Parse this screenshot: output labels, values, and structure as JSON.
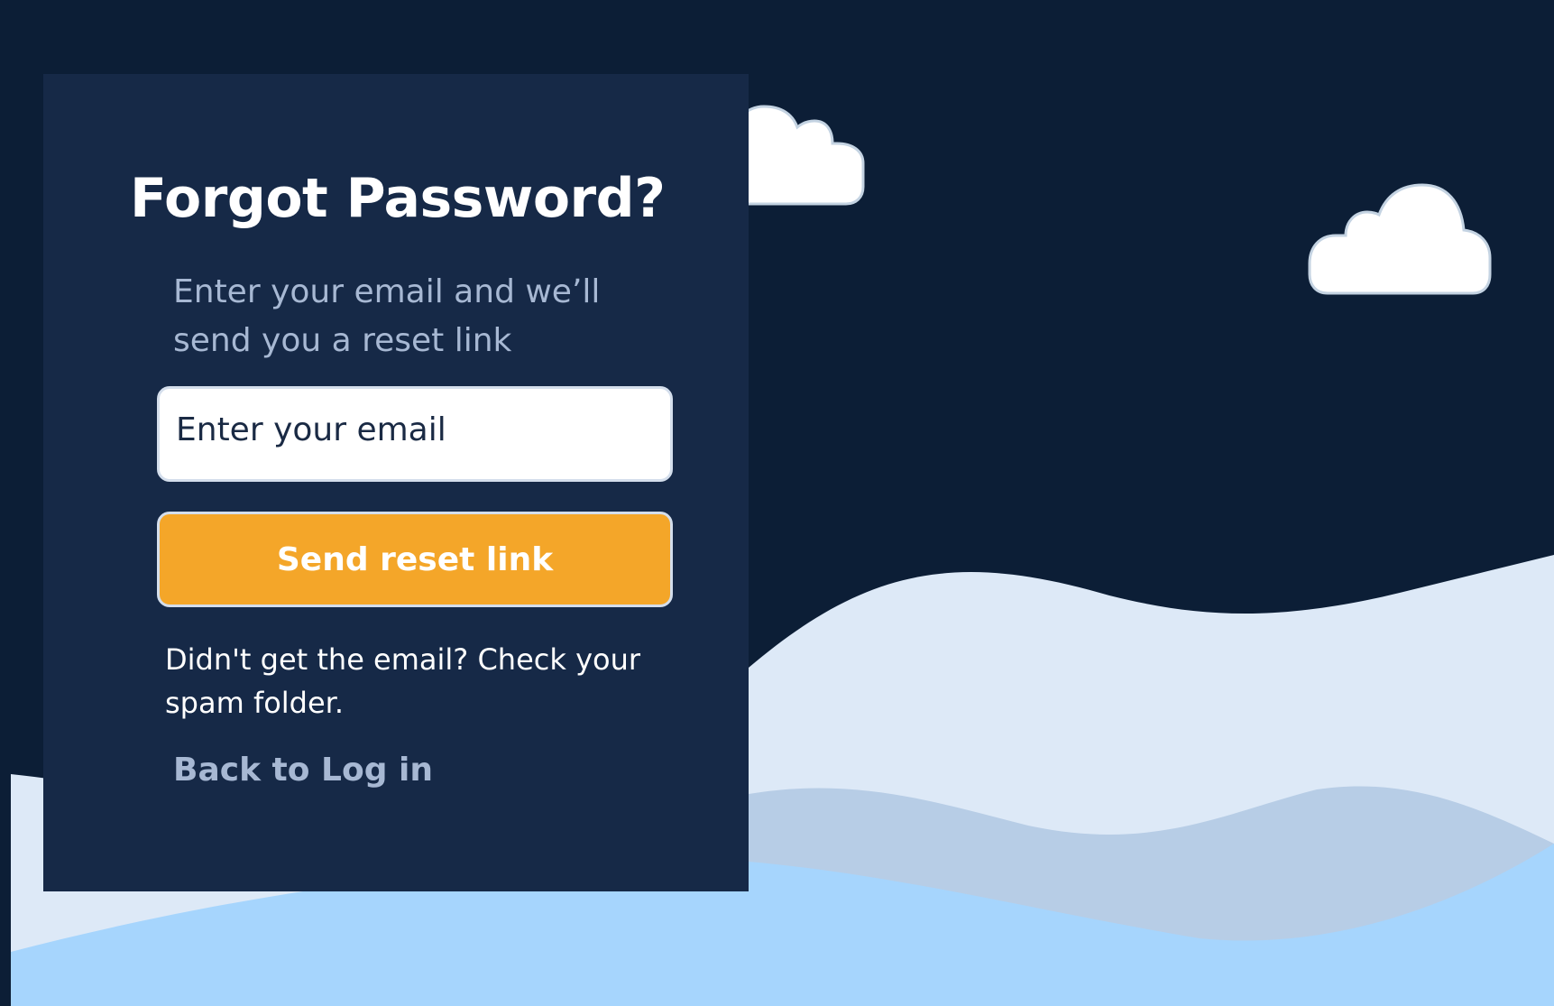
{
  "colors": {
    "sky": "#0c1e36",
    "panel": "#162947",
    "accent": "#f4a629",
    "muted_text": "#a7b8d3",
    "wave_back": "#dde9f7",
    "wave_mid": "#b7cde6",
    "wave_front": "#a6d5fd"
  },
  "background": {
    "decorations": [
      "cloud-icon",
      "cloud-icon",
      "wave",
      "wave",
      "wave"
    ]
  },
  "form": {
    "title": "Forgot Password?",
    "subtitle": "Enter your email and we’ll send you a reset link",
    "email": {
      "placeholder": "Enter your email",
      "value": ""
    },
    "submit_label": "Send reset link",
    "hint": "Didn't get the email? Check your spam folder.",
    "back_link_label": "Back to Log in"
  }
}
